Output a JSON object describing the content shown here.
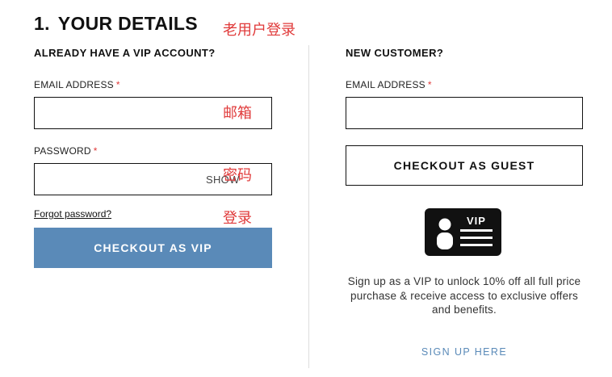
{
  "step": {
    "number": "1.",
    "title": "YOUR DETAILS"
  },
  "annotations": {
    "returning_user_login": "老用户登录",
    "email": "邮箱",
    "password": "密码",
    "login": "登录"
  },
  "vip": {
    "heading": "ALREADY HAVE A VIP ACCOUNT?",
    "email_label": "EMAIL ADDRESS",
    "email_value": "",
    "password_label": "PASSWORD",
    "password_value": "",
    "show_label": "SHOW",
    "forgot_label": "Forgot password?",
    "checkout_label": "CHECKOUT AS VIP"
  },
  "guest": {
    "heading": "NEW CUSTOMER?",
    "email_label": "EMAIL ADDRESS",
    "email_value": "",
    "checkout_label": "CHECKOUT AS GUEST",
    "card_icon_text": "VIP",
    "promo_text": "Sign up as a VIP to unlock 10% off all full price purchase & receive access to exclusive offers and benefits.",
    "signup_label": "SIGN UP HERE"
  },
  "required_marker": "*",
  "colors": {
    "accent": "#5a8ab8",
    "required": "#e03a3a",
    "annotation": "#e03a3a",
    "border": "#111111"
  }
}
